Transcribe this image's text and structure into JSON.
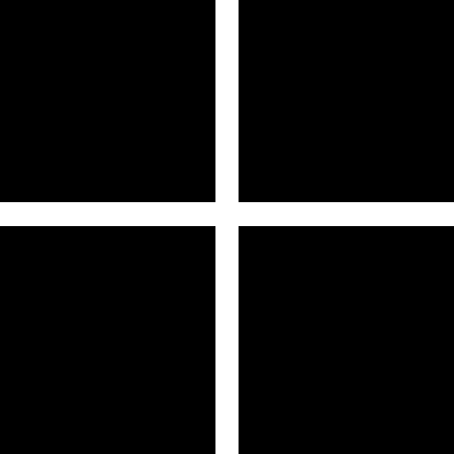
{
  "icon": {
    "name": "four-square-grid-icon",
    "fill_color": "#000000",
    "background_color": "#ffffff",
    "tiles": [
      "top-left",
      "top-right",
      "bottom-left",
      "bottom-right"
    ]
  }
}
